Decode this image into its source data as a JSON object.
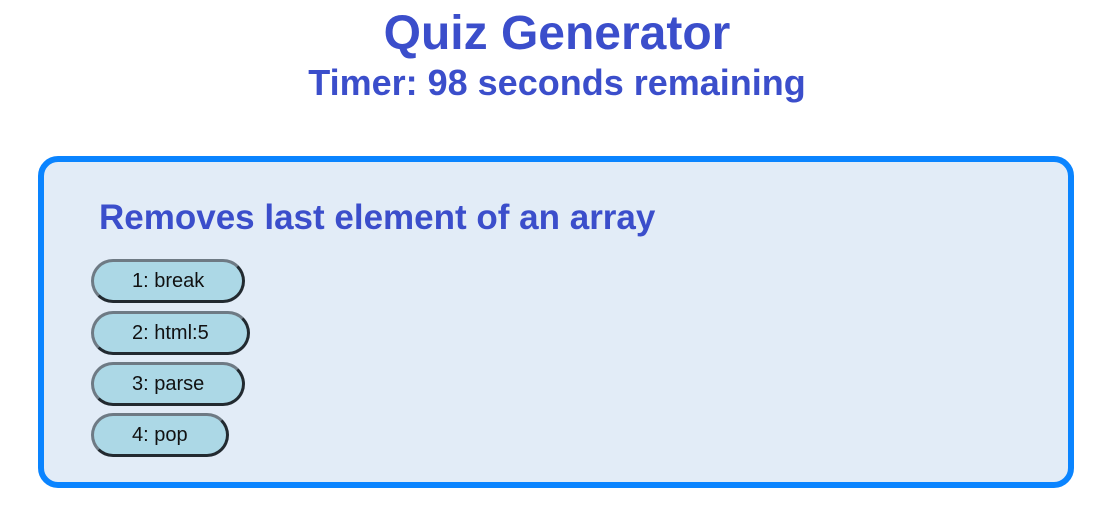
{
  "header": {
    "title": "Quiz Generator",
    "timer_text": "Timer: 98 seconds remaining",
    "timer_seconds": 98
  },
  "quiz": {
    "question": "Removes last element of an array",
    "answers": [
      {
        "label": "1: break"
      },
      {
        "label": "2: html:5"
      },
      {
        "label": "3: parse"
      },
      {
        "label": "4: pop"
      }
    ]
  },
  "colors": {
    "heading": "#3b4ecb",
    "card_border": "#0a84ff",
    "card_background": "#e2ecf7",
    "answer_background": "#acd8e6"
  }
}
